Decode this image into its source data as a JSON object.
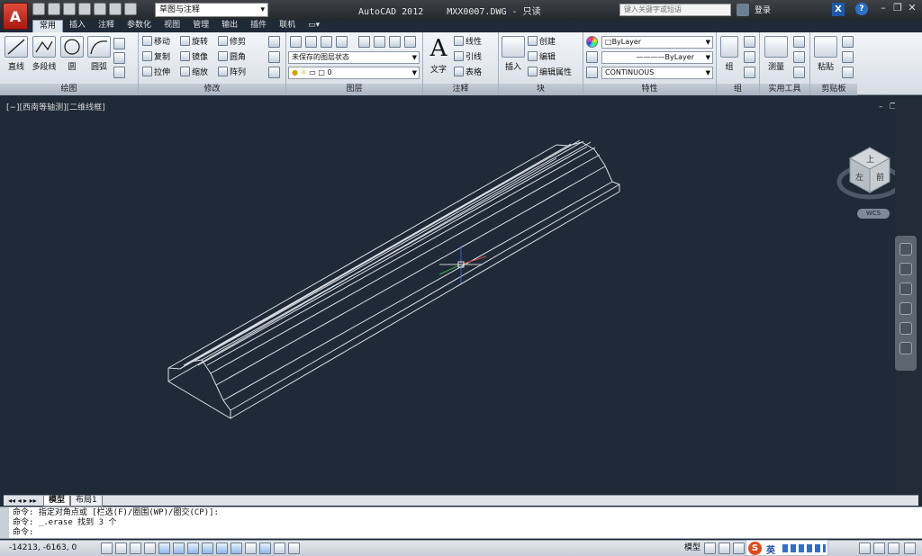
{
  "app": {
    "logo_letter": "A",
    "title": "AutoCAD 2012",
    "filename": "MXX0007.DWG - 只读",
    "workspace": "草图与注释",
    "search_placeholder": "键入关键字或短语",
    "login_label": "登录",
    "help_label": "?",
    "xchange_label": "X"
  },
  "tabs": [
    "常用",
    "插入",
    "注释",
    "参数化",
    "视图",
    "管理",
    "输出",
    "插件",
    "联机"
  ],
  "active_tab": "常用",
  "ribbon": {
    "draw": {
      "title": "绘图",
      "line": "直线",
      "polyline": "多段线",
      "circle": "圆",
      "arc": "圆弧"
    },
    "modify": {
      "title": "修改",
      "move": "移动",
      "rotate": "旋转",
      "trim": "修剪",
      "copy": "复制",
      "mirror": "镜像",
      "fillet": "圆角",
      "stretch": "拉伸",
      "scale": "缩放",
      "array": "阵列"
    },
    "layers": {
      "title": "图层",
      "layer_state": "未保存的图层状态",
      "current_layer": "0"
    },
    "annotation": {
      "title": "注释",
      "text": "文字",
      "linear": "线性",
      "leader": "引线",
      "table": "表格"
    },
    "block": {
      "title": "块",
      "insert": "插入",
      "create": "创建",
      "edit": "编辑",
      "edit_attr": "编辑属性"
    },
    "properties": {
      "title": "特性",
      "color": "ByLayer",
      "linetype": "ByLayer",
      "lineweight": "CONTINUOUS"
    },
    "groups": {
      "title": "组",
      "group": "组"
    },
    "utilities": {
      "title": "实用工具",
      "measure": "测量"
    },
    "clipboard": {
      "title": "剪贴板",
      "paste": "粘贴"
    }
  },
  "viewport": {
    "label": "[−][西南等轴测][二维线框]",
    "viewcube_top": "上",
    "viewcube_left": "左",
    "viewcube_front": "前",
    "wcs": "WCS"
  },
  "layout_tabs": [
    "模型",
    "布局1"
  ],
  "command_lines": [
    "命令: 指定对角点或 [栏选(F)/圈围(WP)/圈交(CP)]:",
    "命令: _.erase 找到 3 个",
    "命令:"
  ],
  "status": {
    "coordinates": "-14213, -6163, 0",
    "model_label": "模型",
    "ime": "英"
  },
  "colors": {
    "viewport_bg": "#1f2a38",
    "geometry": "#d9dde2",
    "ucs_x": "#d14a3a",
    "ucs_y": "#3fb34a",
    "ucs_z": "#3a5fd1"
  }
}
